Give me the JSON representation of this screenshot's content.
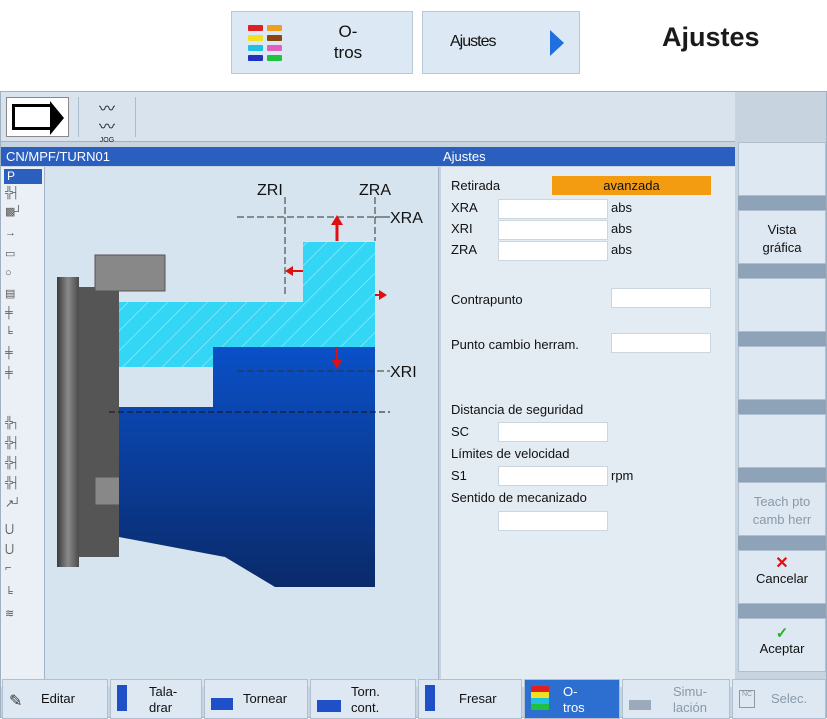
{
  "header": {
    "otros_button": {
      "label": "O-\ntros"
    },
    "ajustes_button": {
      "label": "Ajustes"
    },
    "page_heading": "Ajustes"
  },
  "topbar": {
    "jog_label": "JOG"
  },
  "titlebar": {
    "path": "CN/MPF/TURN01",
    "panel_title": "Ajustes"
  },
  "leftstrip": {
    "p_label": "P"
  },
  "drawing": {
    "labels": {
      "zri": "ZRI",
      "zra": "ZRA",
      "xra": "XRA",
      "xri": "XRI"
    }
  },
  "form": {
    "retirada_label": "Retirada",
    "retirada_value": "avanzada",
    "xra_label": "XRA",
    "xra_value": "",
    "xra_unit": "abs",
    "xri_label": "XRI",
    "xri_value": "",
    "xri_unit": "abs",
    "zra_label": "ZRA",
    "zra_value": "",
    "zra_unit": "abs",
    "contrapunto_label": "Contrapunto",
    "contrapunto_value": "",
    "punto_cambio_label": "Punto cambio herram.",
    "punto_cambio_value": "",
    "distancia_label": "Distancia de seguridad",
    "sc_label": "SC",
    "sc_value": "",
    "limites_label": "Límites de velocidad",
    "s1_label": "S1",
    "s1_value": "",
    "s1_unit": "rpm",
    "sentido_label": "Sentido de mecanizado",
    "sentido_value": ""
  },
  "statusbar": {
    "more_label": ">"
  },
  "softkeys_right": {
    "vista": "Vista\ngráfica",
    "teach": "Teach pto\ncamb herr",
    "cancelar": "Cancelar",
    "aceptar": "Aceptar"
  },
  "softkeys_bottom": {
    "editar": "Editar",
    "taladrar": "Tala-\ndrar",
    "tornear": "Tornear",
    "torn_cont": "Torn.\ncont.",
    "fresar": "Fresar",
    "otros": "O-\ntros",
    "simulacion": "Simu-\nlación",
    "selec": "Selec."
  },
  "colors": {
    "title_blue": "#2b5fbf",
    "orange_select": "#f39c12",
    "active_blue": "#2d6fd1",
    "cyan_stock": "#33d6f5",
    "deep_blue": "#0b4fbf"
  }
}
